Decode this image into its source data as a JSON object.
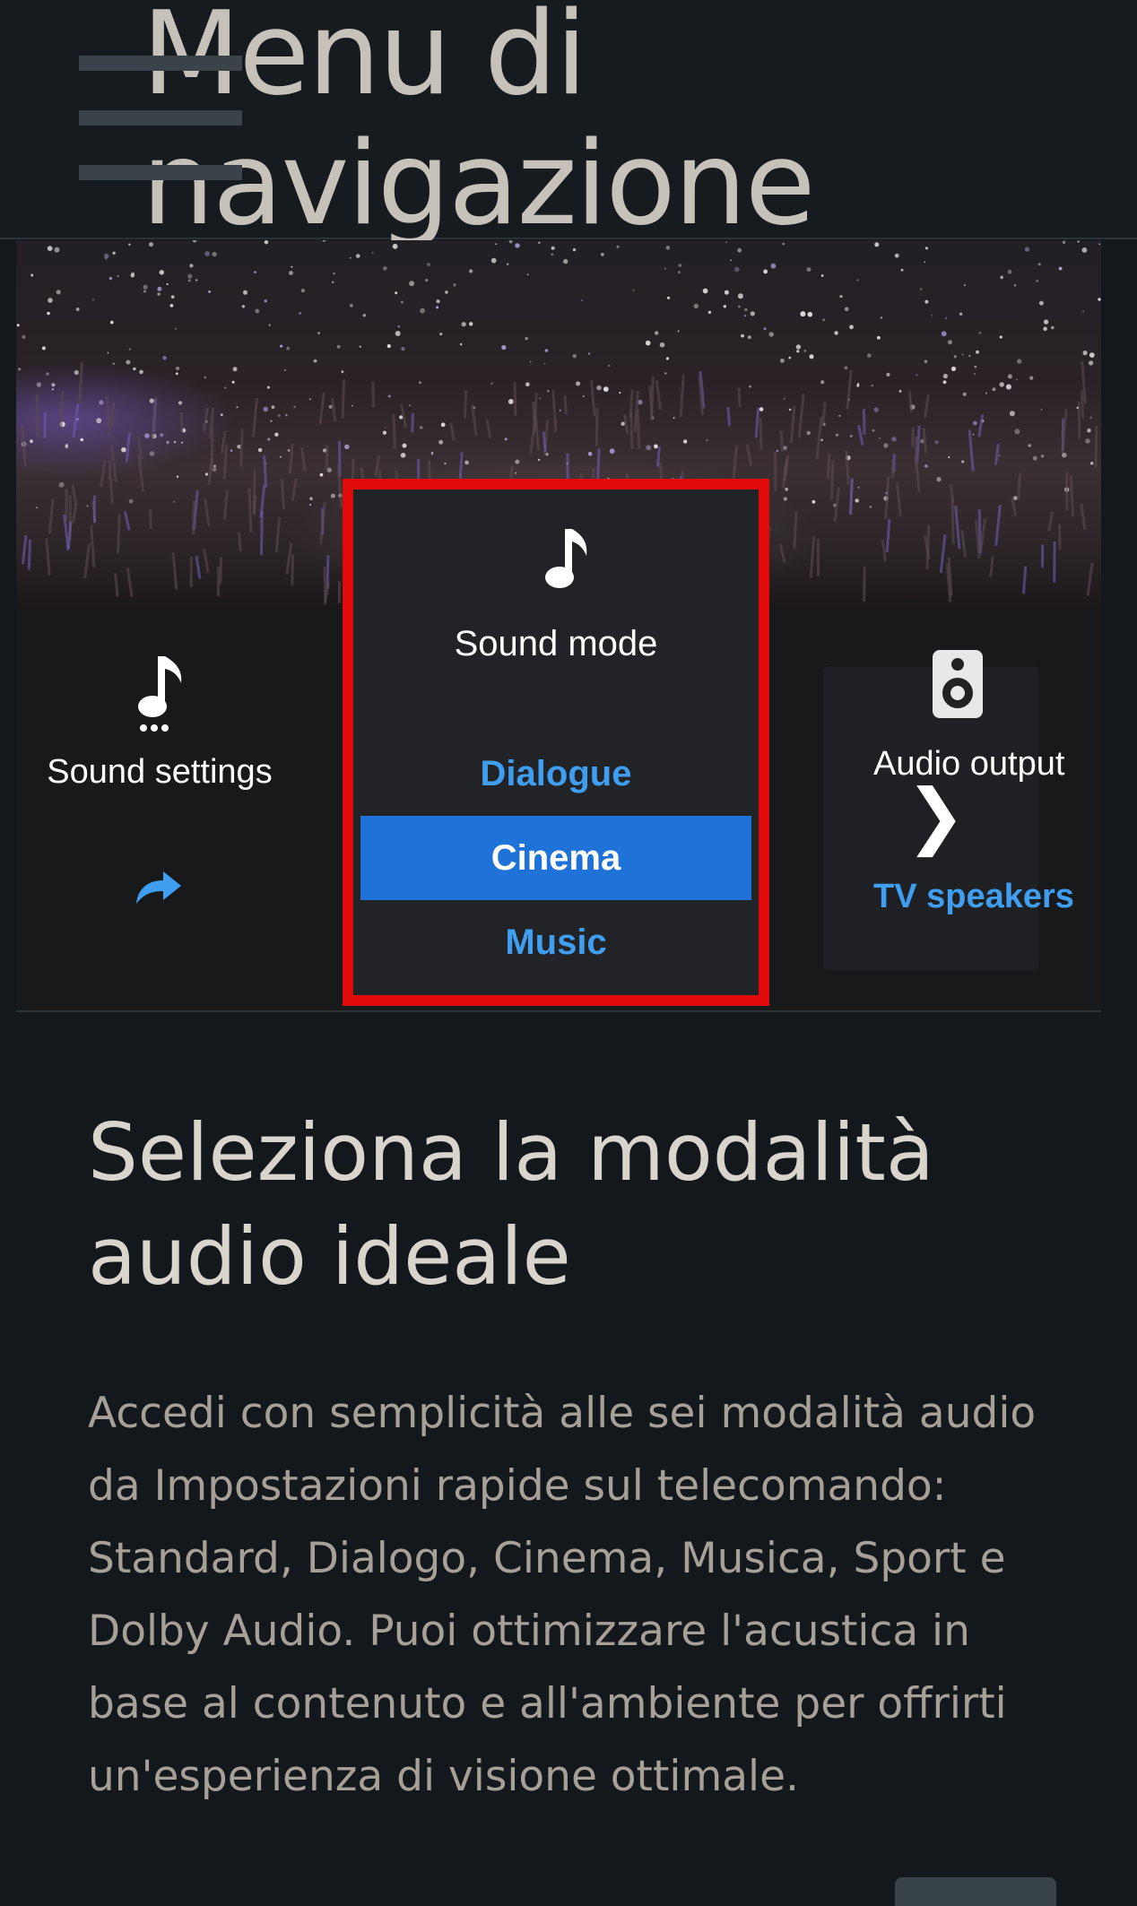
{
  "header": {
    "menu_icon": "hamburger-menu-icon",
    "title_line1": "Menu di",
    "title_line2": "navigazione"
  },
  "tv_menu": {
    "left_tile": {
      "icon": "music-note-settings-icon",
      "label": "Sound settings",
      "action_icon": "share-arrow-icon"
    },
    "center_tile": {
      "icon": "music-note-icon",
      "title": "Sound mode",
      "options": [
        {
          "label": "Dialogue",
          "selected": false
        },
        {
          "label": "Cinema",
          "selected": true
        },
        {
          "label": "Music",
          "selected": false
        }
      ]
    },
    "right_tile": {
      "icon": "speaker-icon",
      "label": "Audio output",
      "chevron": "❯",
      "value": "TV speakers"
    }
  },
  "article": {
    "heading": "Seleziona la modalità audio ideale",
    "body": "Accedi con semplicità alle sei modalità audio da Impostazioni rapide sul telecomando: Standard, Dialogo, Cinema, Musica, Sport e Dolby Audio. Puoi ottimizzare l'acustica in base al contenuto e all'ambiente per offrirti un'esperienza di visione ottimale."
  },
  "colors": {
    "background": "#13181c",
    "highlight_border": "#e10a0a",
    "accent_blue": "#3f9ef0",
    "selected_blue": "#1f73d8"
  }
}
